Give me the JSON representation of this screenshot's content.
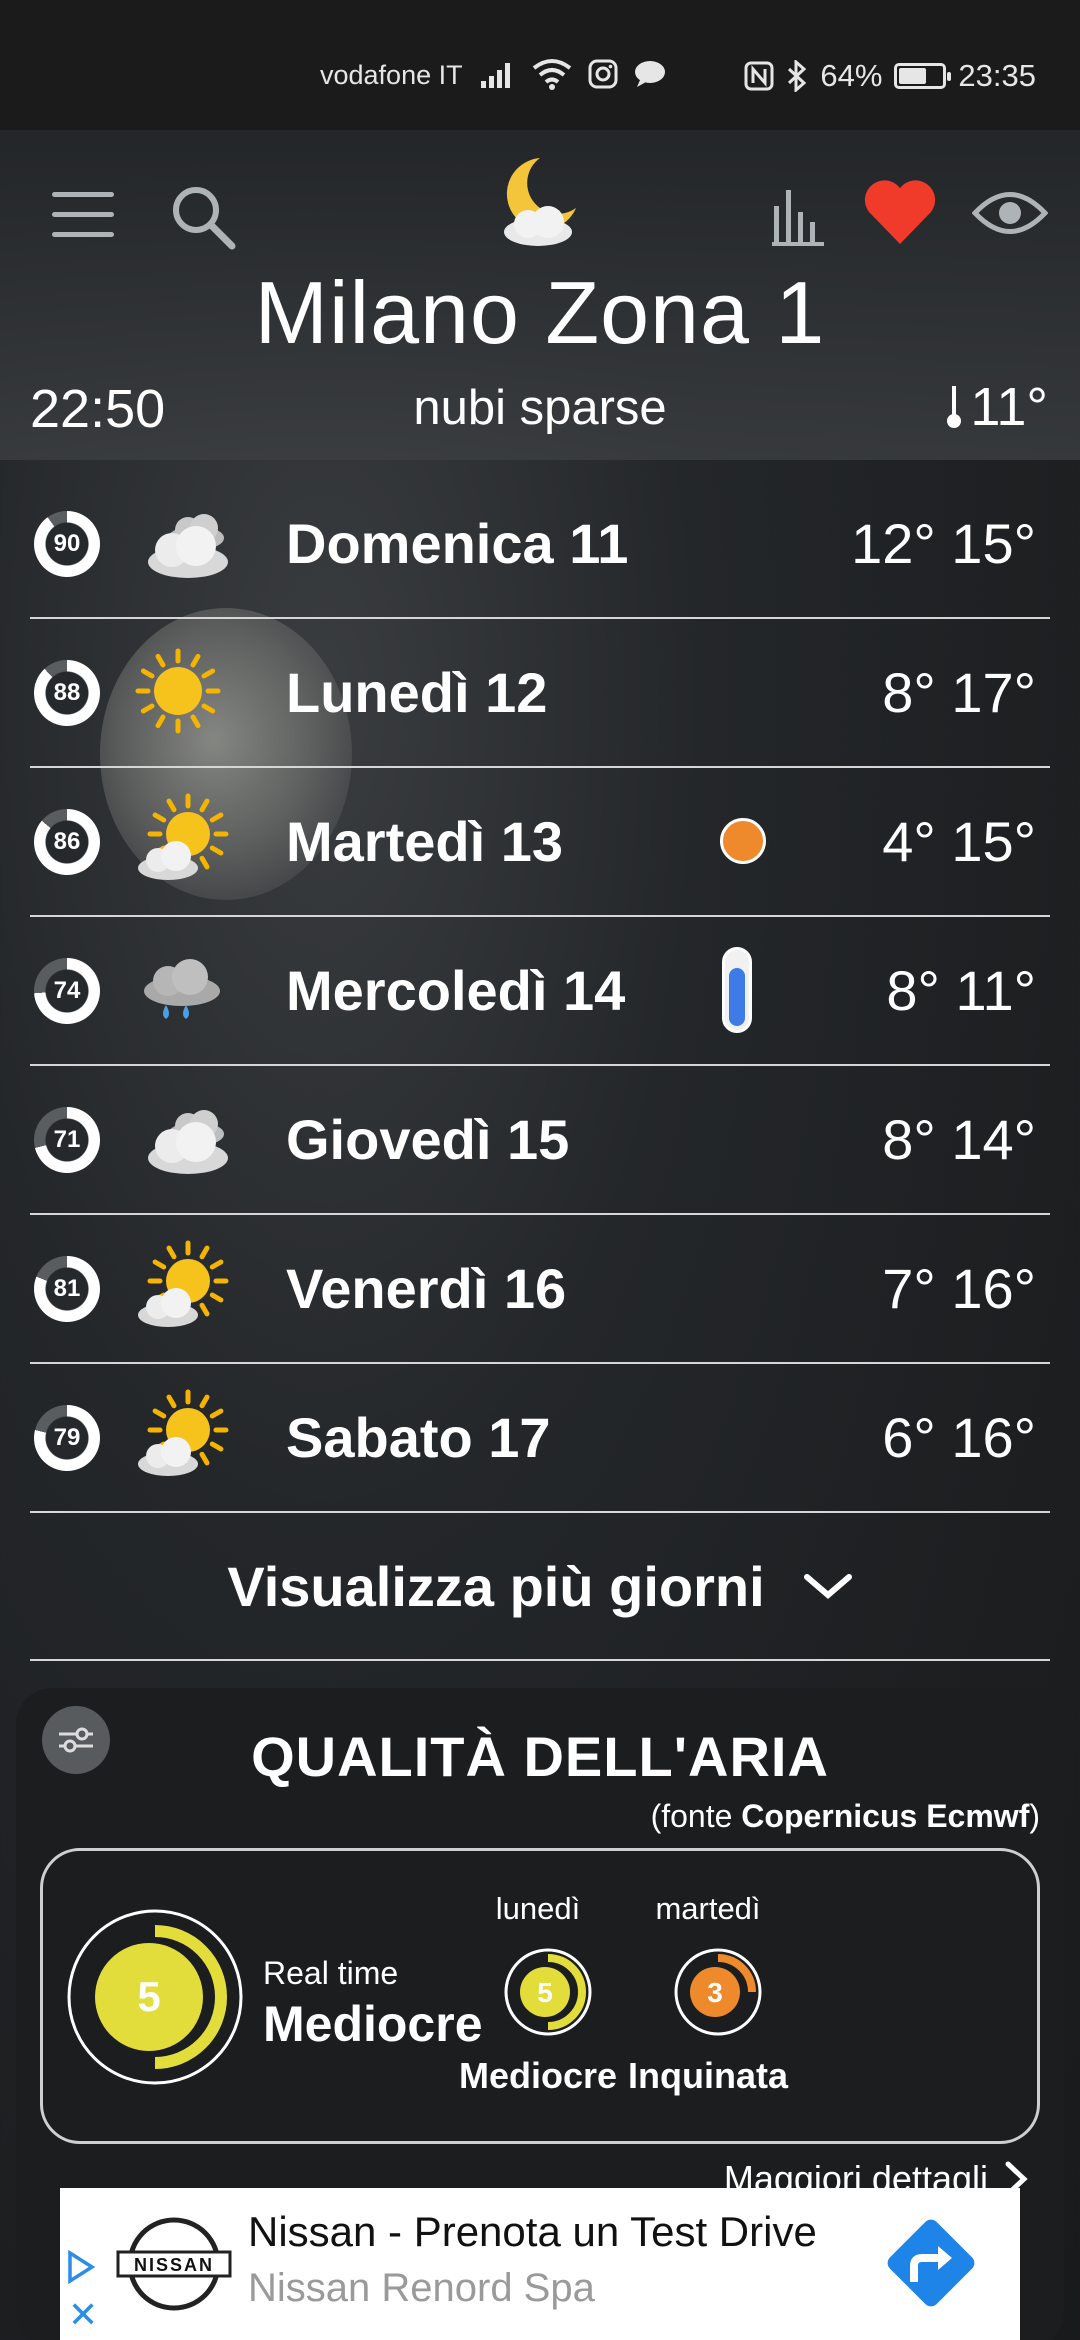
{
  "status_bar": {
    "carrier": "vodafone IT",
    "battery": "64%",
    "battery_level": 0.64,
    "time": "23:35"
  },
  "header": {
    "city": "Milano Zona 1",
    "obs_time": "22:50",
    "obs_desc": "nubi sparse",
    "obs_temp": "11°",
    "icons": [
      "menu-icon",
      "search-icon",
      "moon-cloud-icon",
      "chart-icon",
      "heart-icon",
      "eye-icon"
    ],
    "heart_color": "#f03a2a"
  },
  "forecast": [
    {
      "score": "90",
      "score_level": 0.9,
      "icon": "cloudy",
      "day": "Domenica 11",
      "temps": "12° 15°"
    },
    {
      "score": "88",
      "score_level": 0.88,
      "icon": "sunny",
      "day": "Lunedì 12",
      "temps": "8° 17°"
    },
    {
      "score": "86",
      "score_level": 0.86,
      "icon": "partly-sunny",
      "day": "Martedì 13",
      "temps": "4° 15°",
      "tag": "orange-dot"
    },
    {
      "score": "74",
      "score_level": 0.74,
      "icon": "rain",
      "day": "Mercoledì 14",
      "temps": "8° 11°",
      "tag": "thermometer"
    },
    {
      "score": "71",
      "score_level": 0.71,
      "icon": "cloudy",
      "day": "Giovedì 15",
      "temps": "8° 14°"
    },
    {
      "score": "81",
      "score_level": 0.81,
      "icon": "partly-sunny",
      "day": "Venerdì 16",
      "temps": "7° 16°"
    },
    {
      "score": "79",
      "score_level": 0.79,
      "icon": "partly-sunny",
      "day": "Sabato 17",
      "temps": "6° 16°"
    }
  ],
  "more_days": "Visualizza più giorni",
  "air_quality": {
    "title": "QUALITÀ DELL'ARIA",
    "source_prefix": "(fonte ",
    "source_name": "Copernicus Ecmwf",
    "source_suffix": ")",
    "realtime_label": "Real time",
    "realtime_value": "5",
    "realtime_status": "Mediocre",
    "realtime_color": "#e2dd3a",
    "days": [
      {
        "label": "lunedì",
        "value": "5",
        "status": "Mediocre",
        "color": "#e2dd3a"
      },
      {
        "label": "martedì",
        "value": "3",
        "status": "Inquinata",
        "color": "#ef8a2c"
      }
    ],
    "more_details": "Maggiori dettagli"
  },
  "ad": {
    "title": "Nissan - Prenota un Test Drive",
    "subtitle": "Nissan Renord Spa",
    "logo_text": "NISSAN",
    "close_symbol": "✕"
  }
}
